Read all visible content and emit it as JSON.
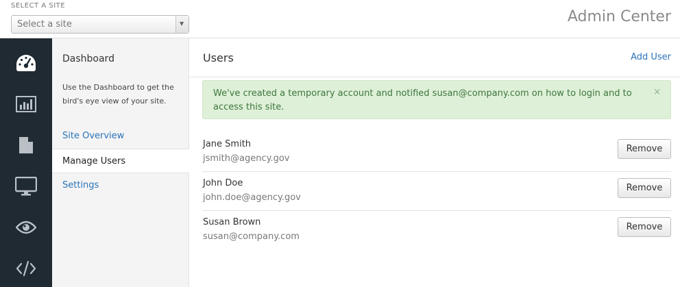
{
  "site_selector": {
    "label": "SELECT A SITE",
    "value": "Select a site"
  },
  "app_title": "Admin Center",
  "rail": [
    {
      "icon": "dashboard-gauge-icon",
      "active": true
    },
    {
      "icon": "bar-chart-icon"
    },
    {
      "icon": "document-icon"
    },
    {
      "icon": "monitor-icon"
    },
    {
      "icon": "eye-icon"
    },
    {
      "icon": "code-icon"
    }
  ],
  "subnav": {
    "title": "Dashboard",
    "description": "Use the Dashboard to get the bird's eye view of your site.",
    "items": [
      {
        "label": "Site Overview"
      },
      {
        "label": "Manage Users",
        "active": true
      },
      {
        "label": "Settings"
      }
    ]
  },
  "main": {
    "title": "Users",
    "add_user_label": "Add User",
    "alert": {
      "text": "We've created a temporary account and notified susan@company.com on how to login and to access this site.",
      "close": "×"
    },
    "users": [
      {
        "name": "Jane Smith",
        "email": "jsmith@agency.gov",
        "action": "Remove"
      },
      {
        "name": "John Doe",
        "email": "john.doe@agency.gov",
        "action": "Remove"
      },
      {
        "name": "Susan Brown",
        "email": "susan@company.com",
        "action": "Remove"
      }
    ]
  },
  "colors": {
    "rail_bg": "#1f2a33",
    "link": "#2a73b8",
    "alert_bg": "#dff0d8",
    "alert_text": "#3c763d"
  }
}
